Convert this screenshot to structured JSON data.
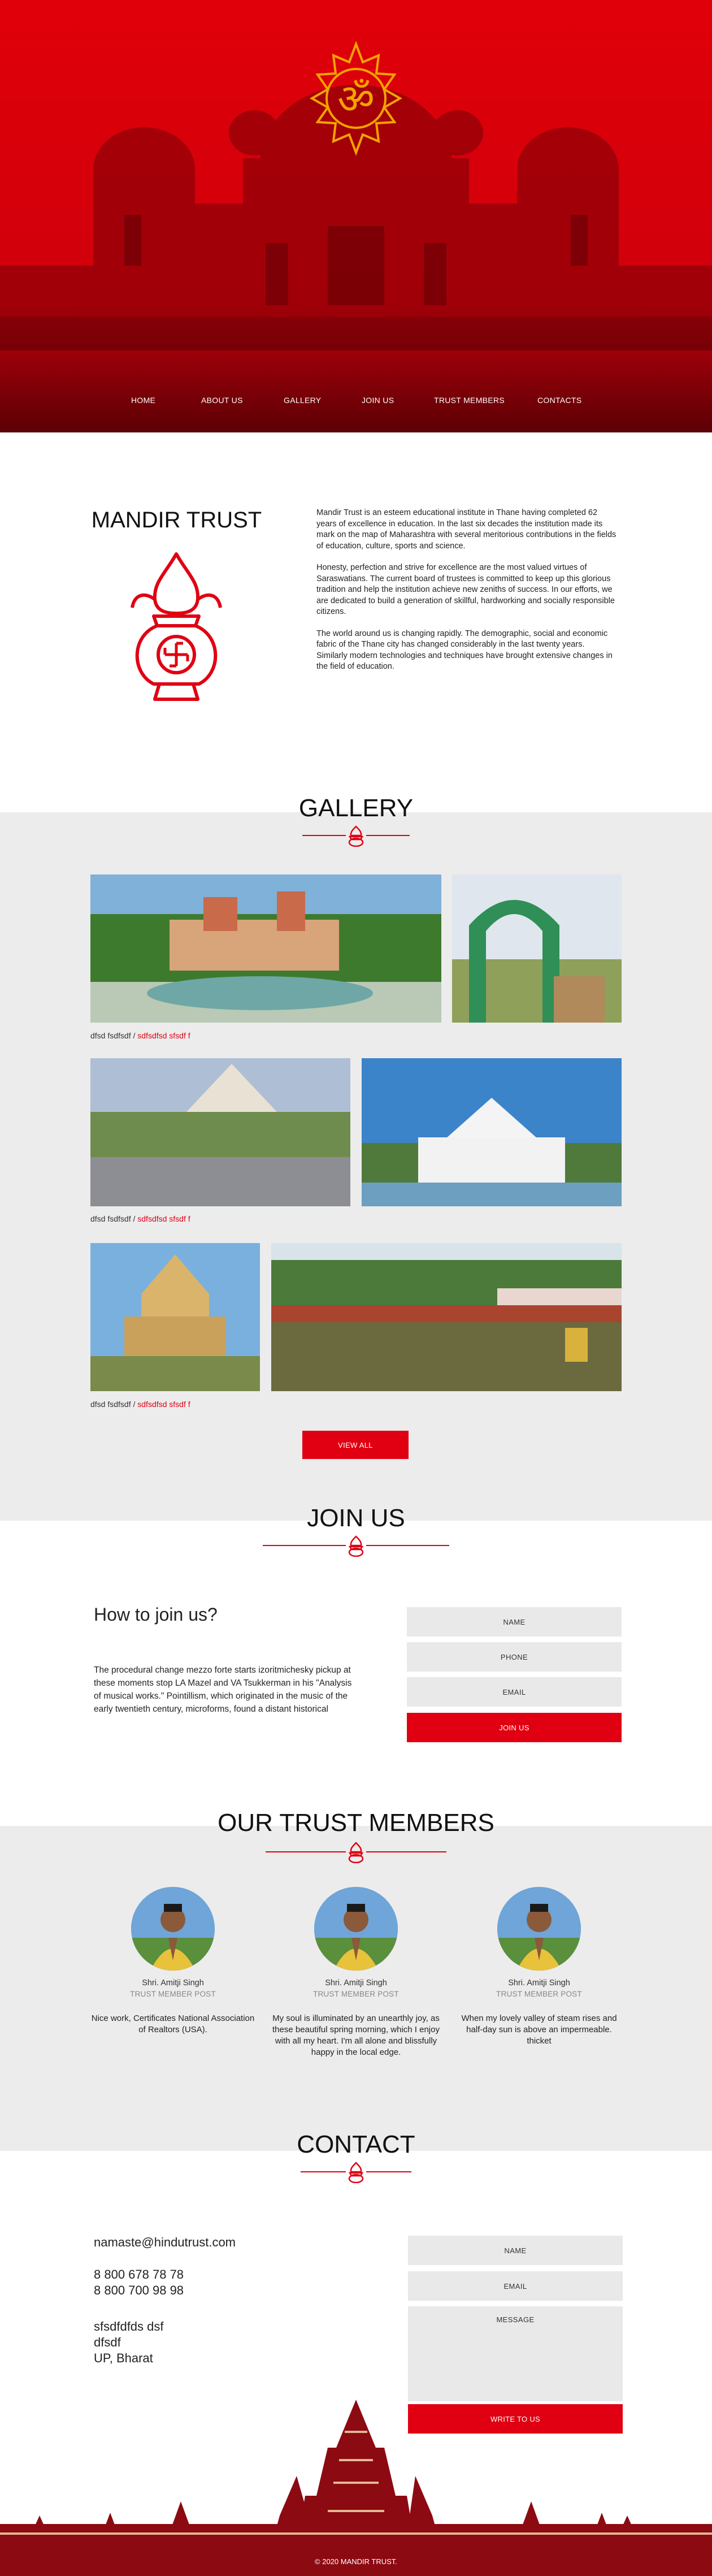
{
  "nav": {
    "items": [
      "HOME",
      "ABOUT US",
      "GALLERY",
      "JOIN US",
      "TRUST MEMBERS",
      "CONTACTS"
    ]
  },
  "about": {
    "title": "MANDIR TRUST",
    "paragraphs": [
      "Mandir Trust is an esteem educational institute in Thane having completed 62 years of excellence in education. In the last six decades the institution made its mark on the map of Maharashtra with several meritorious contributions in the fields of education, culture, sports and science.",
      "Honesty, perfection and strive for excellence are the most valued virtues of Saraswatians. The current board of trustees is committed to keep up this glorious tradition and help the institution achieve new zeniths of success. In our efforts, we are dedicated to build a generation of skillful, hardworking and socially responsible citizens.",
      "The world around us is changing rapidly. The demographic, social and economic fabric of the Thane city has changed considerably in the last twenty years. Similarly modern technologies and techniques have brought extensive changes in the field of education."
    ]
  },
  "gallery": {
    "title": "GALLERY",
    "rows": [
      {
        "caption_plain": "dfsd fsdfsdf / ",
        "caption_red": "sdfsdfsd sfsdf f"
      },
      {
        "caption_plain": "dfsd fsdfsdf / ",
        "caption_red": "sdfsdfsd sfsdf f"
      },
      {
        "caption_plain": "dfsd fsdfsdf / ",
        "caption_red": "sdfsdfsd sfsdf f"
      }
    ],
    "view_all": "VIEW ALL"
  },
  "join": {
    "title": "JOIN US",
    "heading": "How to join us?",
    "text": "The procedural change mezzo forte starts izoritmichesky pickup at these moments stop LA Mazel and VA Tsukkerman in his \"Analysis of musical works.\" Pointillism, which originated in the music of the early twentieth century, microforms, found a distant historical",
    "fields": [
      "NAME",
      "PHONE",
      "EMAIL"
    ],
    "button": "JOIN US"
  },
  "members": {
    "title": "OUR TRUST MEMBERS",
    "list": [
      {
        "name": "Shri. Amitji Singh",
        "post": "TRUST MEMBER POST",
        "quote": "Nice work, Certificates National Association of Realtors (USA)."
      },
      {
        "name": "Shri. Amitji Singh",
        "post": "TRUST MEMBER POST",
        "quote": "My soul is illuminated by an unearthly joy, as these beautiful spring morning, which I enjoy with all my heart. I'm all alone and blissfully happy in the local edge."
      },
      {
        "name": "Shri. Amitji Singh",
        "post": "TRUST MEMBER POST",
        "quote": "When my lovely valley of steam rises and half-day sun is above an impermeable. thicket"
      }
    ]
  },
  "contact": {
    "title": "CONTACT",
    "email": "namaste@hindutrust.com",
    "phones": [
      "8 800 678 78 78",
      "8 800 700 98 98"
    ],
    "address": [
      "sfsdfdfds dsf",
      "dfsdf",
      "UP, Bharat"
    ],
    "fields": [
      "NAME",
      "EMAIL"
    ],
    "message": "MESSAGE",
    "button": "WRITE TO US"
  },
  "footer": {
    "text": "© 2020 MANDIR TRUST."
  },
  "colors": {
    "brand_red": "#e00012",
    "dark_red": "#8c0a12",
    "section_gray": "#ececec"
  }
}
